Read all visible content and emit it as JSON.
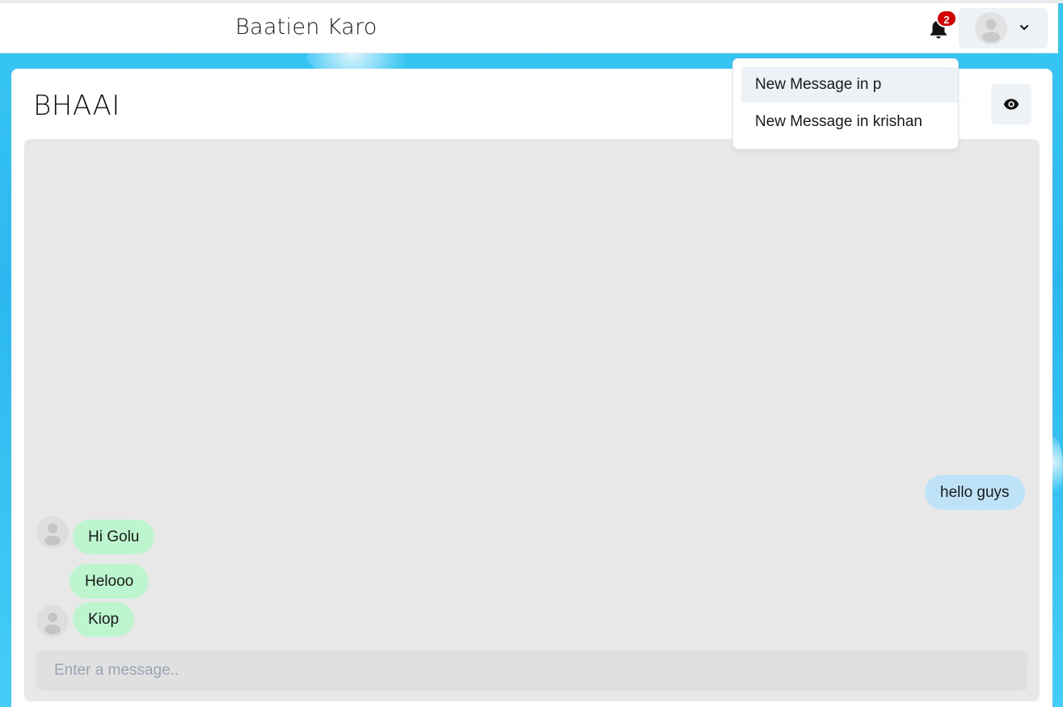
{
  "app": {
    "brand": "Baatien Karo"
  },
  "header": {
    "notification_count": "2",
    "bell_icon": "bell-icon",
    "profile_chevron_icon": "chevron-down-icon"
  },
  "notifications": {
    "items": [
      {
        "label": "New Message in p"
      },
      {
        "label": "New Message in krishan"
      }
    ]
  },
  "chat": {
    "title": "BHAAI",
    "view_icon": "eye-icon",
    "messages": [
      {
        "text": "hello guys",
        "sender": "self"
      },
      {
        "text": "Hi Golu",
        "sender": "other"
      },
      {
        "text": "Helooo",
        "sender": "other"
      },
      {
        "text": "Kiop",
        "sender": "other"
      }
    ],
    "input_placeholder": "Enter a message.."
  },
  "colors": {
    "background": "#2bb8f0",
    "bubble_other": "#bdf5cf",
    "bubble_self": "#bee3f8",
    "badge": "#d40000"
  }
}
